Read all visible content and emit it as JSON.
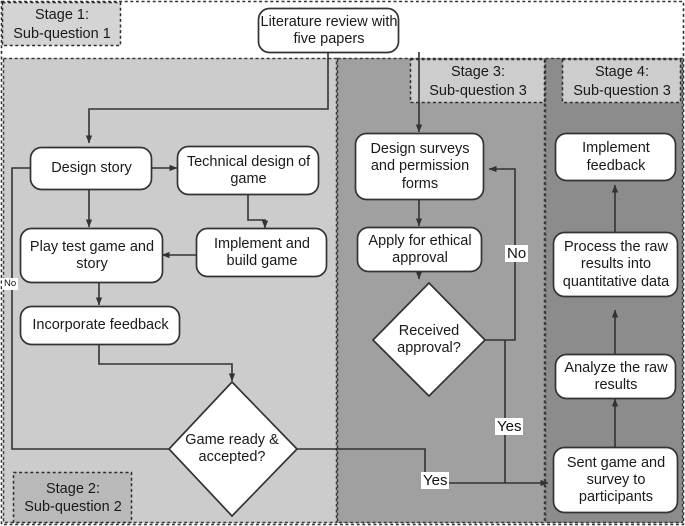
{
  "diagram": {
    "title": "Research methodology flowchart",
    "colors": {
      "panel_stage12": "#cccccc",
      "panel_stage3": "#a0a0a0",
      "panel_stage4": "#8c8c8c",
      "stage_label_fill": "#d4d4d4",
      "node_fill": "#ffffff",
      "stroke": "#404040",
      "text": "#1a1a1a",
      "page": "#ffffff"
    }
  },
  "stages": [
    {
      "id": "stage1",
      "line1": "Stage 1:",
      "line2": "Sub-question 1",
      "label": "Stage 1:\nSub-question 1"
    },
    {
      "id": "stage2",
      "line1": "Stage 2:",
      "line2": "Sub-question 2",
      "label": "Stage 2:\nSub-question 2"
    },
    {
      "id": "stage3",
      "line1": "Stage 3:",
      "line2": "Sub-question 3",
      "label": "Stage 3:\nSub-question 3"
    },
    {
      "id": "stage4",
      "line1": "Stage 4:",
      "line2": "Sub-question 3",
      "label": "Stage 4:\nSub-question 3"
    }
  ],
  "nodes": {
    "literature_review": {
      "text": "Literature review with\nfive papers",
      "shape": "rounded-rect"
    },
    "design_story": {
      "text": "Design story",
      "shape": "rounded-rect"
    },
    "technical_design": {
      "text": "Technical design of\ngame",
      "shape": "rounded-rect"
    },
    "implement_build": {
      "text": "Implement and\nbuild game",
      "shape": "rounded-rect"
    },
    "play_test": {
      "text": "Play test game and\nstory",
      "shape": "rounded-rect"
    },
    "incorporate_feedback": {
      "text": "Incorporate feedback",
      "shape": "rounded-rect"
    },
    "game_ready": {
      "text": "Game ready &\naccepted?",
      "shape": "diamond"
    },
    "design_surveys": {
      "text": "Design surveys\nand permission\nforms",
      "shape": "rounded-rect"
    },
    "apply_ethical": {
      "text": "Apply for ethical\napproval",
      "shape": "rounded-rect"
    },
    "received_approval": {
      "text": "Received\napproval?",
      "shape": "diamond"
    },
    "sent_game": {
      "text": "Sent game and\nsurvey to\nparticipants",
      "shape": "rounded-rect"
    },
    "analyze_raw": {
      "text": "Analyze the raw\nresults",
      "shape": "rounded-rect"
    },
    "process_raw": {
      "text": "Process the raw\nresults into\nquantitative data",
      "shape": "rounded-rect"
    },
    "implement_feedback": {
      "text": "Implement\nfeedback",
      "shape": "rounded-rect"
    }
  },
  "edge_labels": {
    "game_ready_no": "No",
    "game_ready_yes": "Yes",
    "received_approval_no": "No",
    "received_approval_yes": "Yes"
  }
}
